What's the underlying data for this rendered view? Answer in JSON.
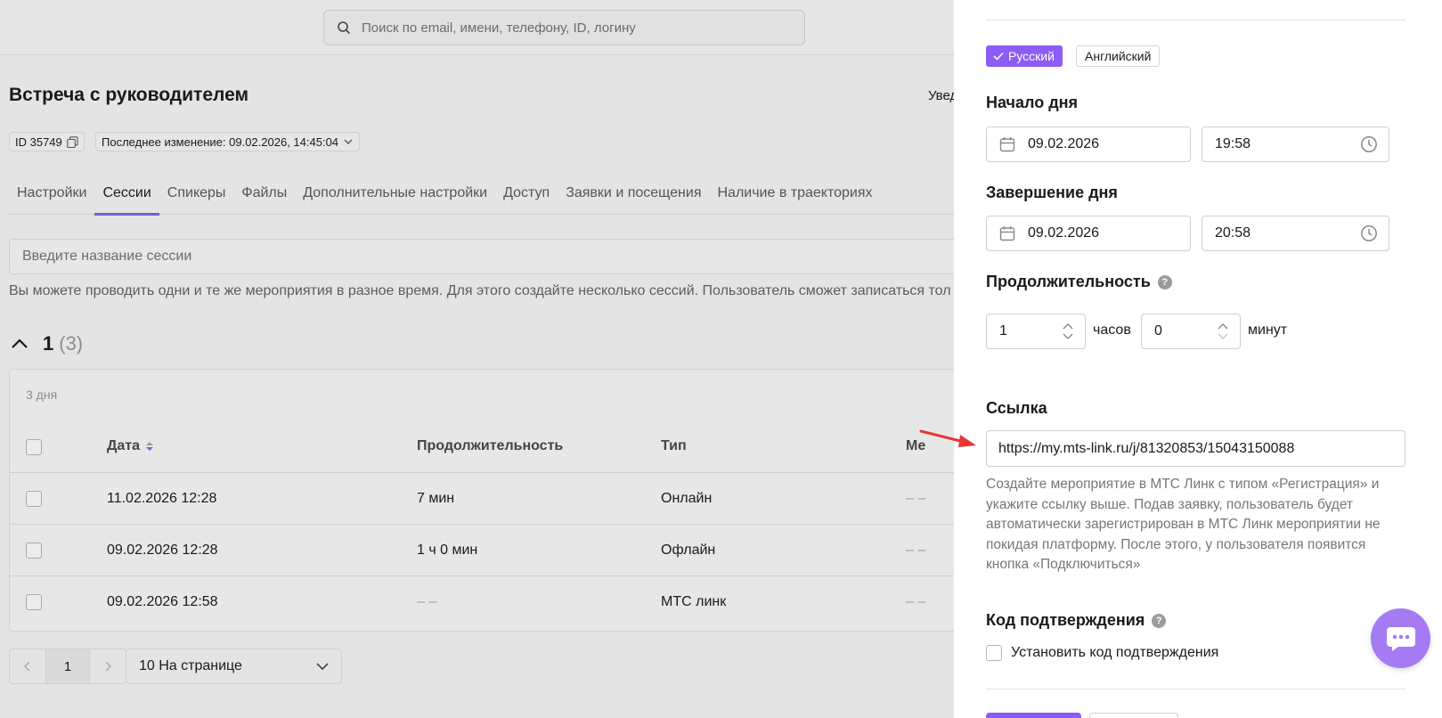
{
  "search": {
    "placeholder": "Поиск по email, имени, телефону, ID, логину"
  },
  "page": {
    "title": "Встреча с руководителем",
    "notif_partial": "Увед",
    "id_chip": "ID 35749",
    "last_change": "Последнее изменение: 09.02.2026, 14:45:04"
  },
  "tabs": [
    {
      "label": "Настройки"
    },
    {
      "label": "Сессии"
    },
    {
      "label": "Спикеры"
    },
    {
      "label": "Файлы"
    },
    {
      "label": "Дополнительные настройки"
    },
    {
      "label": "Доступ"
    },
    {
      "label": "Заявки и посещения"
    },
    {
      "label": "Наличие в траекториях"
    }
  ],
  "active_tab": "Сессии",
  "session": {
    "input_placeholder": "Введите название сессии",
    "hint": "Вы можете проводить одни и те же мероприятия в разное время. Для этого создайте несколько сессий. Пользователь сможет записаться тол",
    "group_number": "1",
    "group_count": "(3)",
    "days": "3 дня"
  },
  "table": {
    "headers": {
      "date": "Дата",
      "duration": "Продолжительность",
      "type": "Тип",
      "more": "Ме"
    },
    "rows": [
      {
        "date": "11.02.2026 12:28",
        "duration": "7 мин",
        "type": "Онлайн",
        "more": "– –"
      },
      {
        "date": "09.02.2026 12:28",
        "duration": "1 ч 0 мин",
        "type": "Офлайн",
        "more": "– –"
      },
      {
        "date": "09.02.2026 12:58",
        "duration": "– –",
        "type": "МТС линк",
        "more": "– –"
      }
    ]
  },
  "pagination": {
    "current_page": "1",
    "per_page": "10 На странице"
  },
  "drawer": {
    "lang_ru": "Русский",
    "lang_en": "Английский",
    "start_label": "Начало дня",
    "start_date": "09.02.2026",
    "start_time": "19:58",
    "end_label": "Завершение дня",
    "end_date": "09.02.2026",
    "end_time": "20:58",
    "duration_label": "Продолжительность",
    "hours_value": "1",
    "hours_unit": "часов",
    "minutes_value": "0",
    "minutes_unit": "минут",
    "link_label": "Ссылка",
    "link_value": "https://my.mts-link.ru/j/81320853/15043150088",
    "link_help": "Создайте мероприятие в МТС Линк с типом «Регистрация» и укажите ссылку выше. Подав заявку, пользователь будет автоматически зарегистрирован в МТС Линк мероприятии не покидая платформу. После этого, у пользователя появится кнопка «Подключиться»",
    "code_label": "Код подтверждения",
    "code_checkbox": "Установить код подтверждения"
  },
  "colors": {
    "accent": "#8b5cf6",
    "chat_fab": "#a57bf4",
    "arrow": "#e53935"
  }
}
